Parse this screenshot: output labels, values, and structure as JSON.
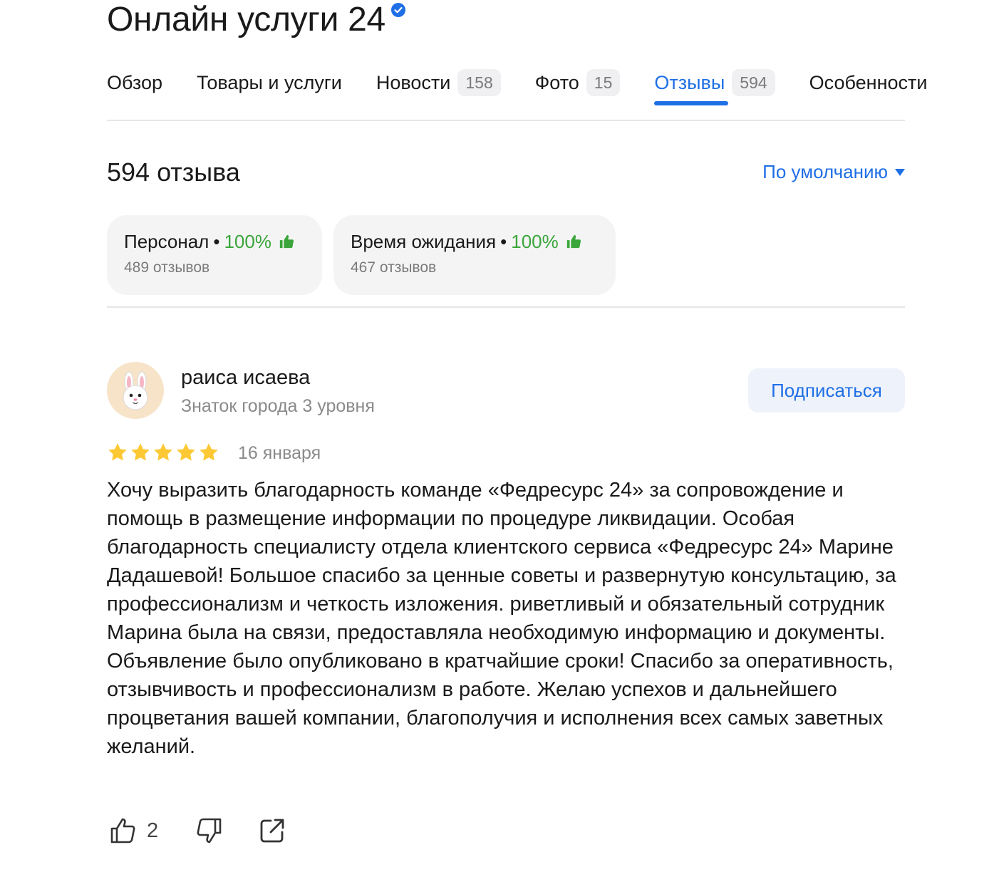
{
  "header": {
    "title": "Онлайн услуги 24",
    "verified_icon": "verified-badge-icon"
  },
  "tabs": [
    {
      "label": "Обзор",
      "count": null,
      "active": false
    },
    {
      "label": "Товары и услуги",
      "count": null,
      "active": false
    },
    {
      "label": "Новости",
      "count": "158",
      "active": false
    },
    {
      "label": "Фото",
      "count": "15",
      "active": false
    },
    {
      "label": "Отзывы",
      "count": "594",
      "active": true
    },
    {
      "label": "Особенности",
      "count": null,
      "active": false
    }
  ],
  "reviews_header": {
    "count_label": "594 отзыва",
    "sort_label": "По умолчанию"
  },
  "aspects": [
    {
      "name": "Персонал",
      "dot": "•",
      "percent": "100%",
      "reviews": "489 отзывов"
    },
    {
      "name": "Время ожидания",
      "dot": "•",
      "percent": "100%",
      "reviews": "467 отзывов"
    }
  ],
  "review": {
    "author": "раиса исаева",
    "level": "Знаток города 3 уровня",
    "subscribe_label": "Подписаться",
    "rating": 5,
    "date": "16 января",
    "text": "Хочу выразить благодарность команде «Федресурс 24» за сопровождение и помощь в размещение информации по процедуре ликвидации. Особая благодарность специалисту отдела клиентского сервиса «Федресурс 24» Марине Дадашевой! Большое спасибо за ценные советы и развернутую консультацию, за профессионализм и четкость изложения. риветливый и обязательный сотрудник Марина была на связи, предоставляла необходимую информацию и документы. Объявление было опубликовано в кратчайшие сроки! Спасибо за оперативность, отзывчивость и профессионализм в работе. Желаю успехов и дальнейшего процветания вашей компании, благополучия и исполнения всех самых заветных желаний.",
    "likes": "2"
  },
  "colors": {
    "accent": "#1f6fe5",
    "positive": "#3aa53a",
    "star": "#fcc934"
  }
}
